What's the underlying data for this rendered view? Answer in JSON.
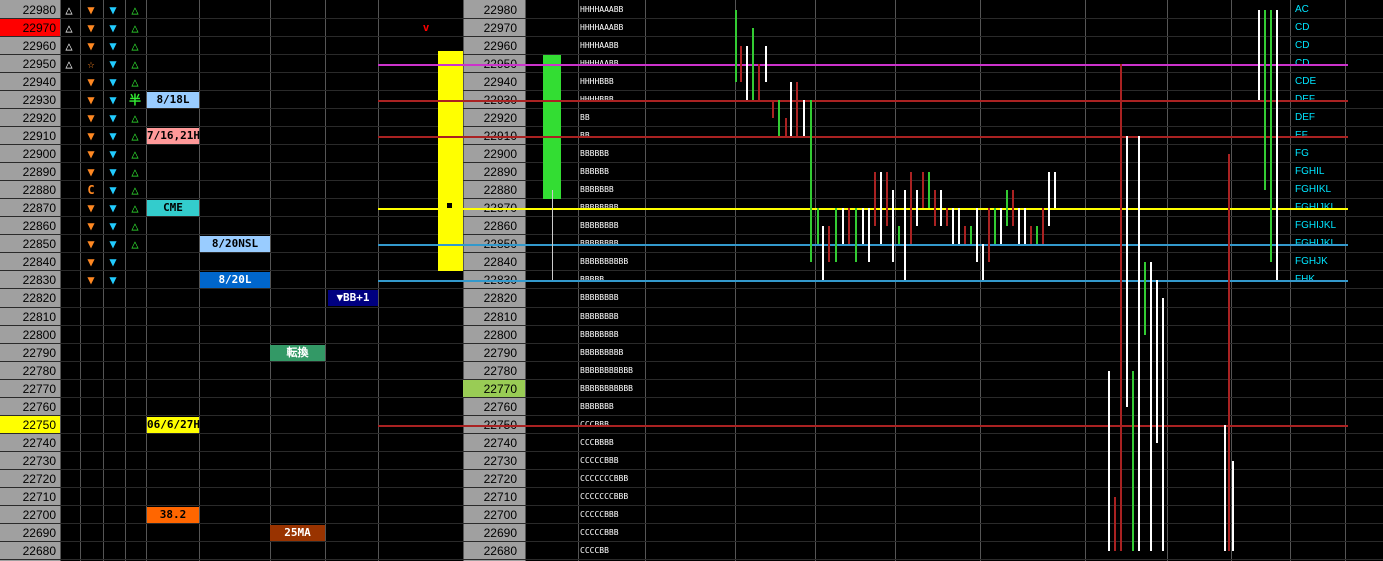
{
  "prices": [
    22980,
    22970,
    22960,
    22950,
    22940,
    22930,
    22920,
    22910,
    22900,
    22890,
    22880,
    22870,
    22860,
    22850,
    22840,
    22830,
    22820,
    22810,
    22800,
    22790,
    22780,
    22770,
    22760,
    22750,
    22740,
    22730,
    22720,
    22710,
    22700,
    22690,
    22680
  ],
  "left_price_highlights": {
    "22970": "#ff0000",
    "22750": "#ffff00"
  },
  "mid_price_highlights": {
    "22770": "#99cc55"
  },
  "col_a": {
    "22980": "△",
    "22970": "△",
    "22960": "△",
    "22950": "△"
  },
  "col_b": {
    "22980": "▼",
    "22970": "▼",
    "22960": "▼",
    "22950": "☆",
    "22940": "▼",
    "22930": "▼",
    "22920": "▼",
    "22910": "▼",
    "22900": "▼",
    "22890": "▼",
    "22880": "C",
    "22870": "▼",
    "22860": "▼",
    "22850": "▼",
    "22840": "▼",
    "22830": "▼"
  },
  "col_c": {
    "22980": "▼",
    "22970": "▼",
    "22960": "▼",
    "22950": "▼",
    "22940": "▼",
    "22930": "▼",
    "22920": "▼",
    "22910": "▼",
    "22900": "▼",
    "22890": "▼",
    "22880": "▼",
    "22870": "▼",
    "22860": "▼",
    "22850": "▼",
    "22840": "▼",
    "22830": "▼"
  },
  "col_d": {
    "22980": "△",
    "22970": "△",
    "22960": "△",
    "22950": "△",
    "22940": "△",
    "22930": "半",
    "22920": "△",
    "22910": "△",
    "22900": "△",
    "22890": "△",
    "22880": "△",
    "22870": "△",
    "22860": "△",
    "22850": "△"
  },
  "tags": [
    {
      "price": 22930,
      "col": 0,
      "text": "8/18L",
      "bg": "#99ccff",
      "fg": "#000000"
    },
    {
      "price": 22910,
      "col": 0,
      "text": "7/16,21H",
      "bg": "#ff9999",
      "fg": "#000000"
    },
    {
      "price": 22870,
      "col": 0,
      "text": "CME",
      "bg": "#33cccc",
      "fg": "#000000"
    },
    {
      "price": 22750,
      "col": 0,
      "text": "06/6/27H",
      "bg": "#ffff00",
      "fg": "#000000"
    },
    {
      "price": 22700,
      "col": 0,
      "text": "38.2",
      "bg": "#ff6600",
      "fg": "#000000"
    },
    {
      "price": 22850,
      "col": 1,
      "text": "8/20NSL",
      "bg": "#99ccff",
      "fg": "#000000"
    },
    {
      "price": 22830,
      "col": 1,
      "text": "8/20L",
      "bg": "#0066cc",
      "fg": "#ffffff"
    },
    {
      "price": 22790,
      "col": 2,
      "text": "転換",
      "bg": "#339966",
      "fg": "#ffffff"
    },
    {
      "price": 22690,
      "col": 2,
      "text": "25MA",
      "bg": "#993300",
      "fg": "#ffffff"
    },
    {
      "price": 22820,
      "col": 3,
      "text": "▼BB+1",
      "bg": "#000080",
      "fg": "#ffffff"
    }
  ],
  "small_marker": {
    "text": "v",
    "color": "#ff0000"
  },
  "tpo_profile": {
    "22980": "HHHHAAABB",
    "22970": "HHHHAAABB",
    "22960": "HHHHAABB",
    "22950": "HHHHAABB",
    "22940": "HHHHBBB",
    "22930": "HHHHBBB",
    "22920": "BB",
    "22910": "BB",
    "22900": "BBBBBB",
    "22890": "BBBBBB",
    "22880": "BBBBBBB",
    "22870": "BBBBBBBB",
    "22860": "BBBBBBBB",
    "22850": "BBBBBBBB",
    "22840": "BBBBBBBBBB",
    "22830": "BBBBB",
    "22820": "BBBBBBBB",
    "22810": "BBBBBBBB",
    "22800": "BBBBBBBB",
    "22790": "BBBBBBBBB",
    "22780": "BBBBBBBBBBB",
    "22770": "BBBBBBBBBBB",
    "22760": "BBBBBBB",
    "22750": "CCCBBB",
    "22740": "CCCBBBB",
    "22730": "CCCCCBBB",
    "22720": "CCCCCCCBBB",
    "22710": "CCCCCCCBBB",
    "22700": "CCCCCBBB",
    "22690": "CCCCCBBB",
    "22680": "CCCCBB"
  },
  "right_labels": {
    "22980": "AC",
    "22970": "CD",
    "22960": "CD",
    "22950": "CD",
    "22940": "CDE",
    "22930": "DEF",
    "22920": "DEF",
    "22910": "EF",
    "22900": "FG",
    "22890": "FGHIL",
    "22880": "FGHIKL",
    "22870": "FGHIJKL",
    "22860": "FGHIJKL",
    "22850": "FGHIJKL",
    "22840": "FGHJK",
    "22830": "FHK"
  },
  "hlines": [
    {
      "price": 22950,
      "color": "#cc33cc"
    },
    {
      "price": 22930,
      "color": "#aa2222"
    },
    {
      "price": 22910,
      "color": "#aa2222"
    },
    {
      "price": 22870,
      "color": "#ffff00"
    },
    {
      "price": 22850,
      "color": "#3399cc"
    },
    {
      "price": 22830,
      "color": "#3399cc"
    },
    {
      "price": 22750,
      "color": "#aa2222"
    }
  ],
  "bars": [
    {
      "from": 22950,
      "to": 22880,
      "color": "#33dd33"
    },
    {
      "from": 22950,
      "to": 22840,
      "color": "#ffff00"
    }
  ]
}
